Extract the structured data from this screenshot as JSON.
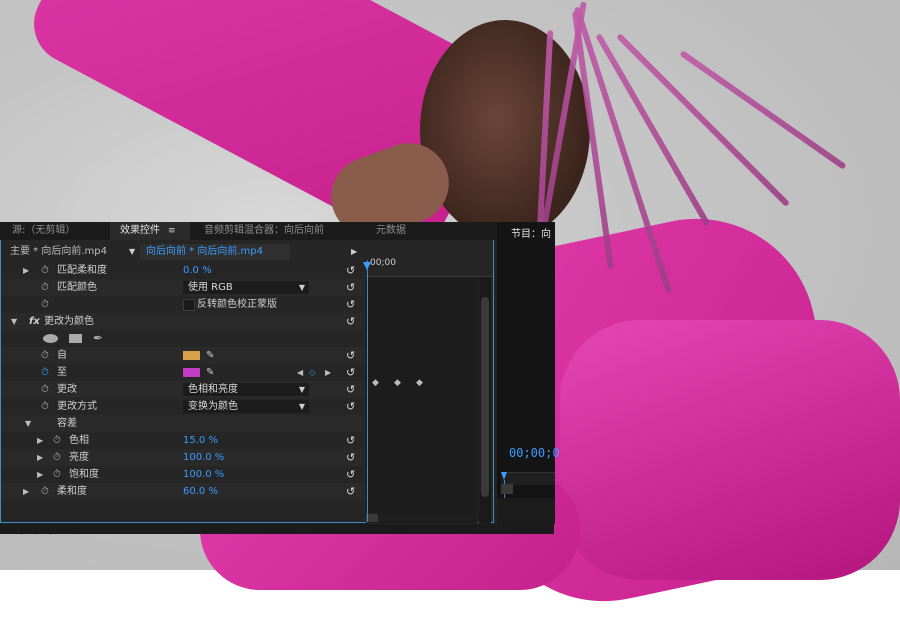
{
  "tabs": {
    "source": "源:（无剪辑）",
    "effect_controls": "效果控件",
    "menu_icon": "≡",
    "audio_mixer": "音频剪辑混合器：向后向前",
    "metadata": "元数据"
  },
  "header": {
    "main_clip": "主要 * 向后向前.mp4",
    "sequence_clip": "向后向前 * 向后向前.mp4",
    "timecode": "00;00"
  },
  "rows": {
    "match_softness": {
      "label": "匹配柔和度",
      "value": "0.0 %"
    },
    "match_colors": {
      "label": "匹配颜色",
      "value": "使用 RGB"
    },
    "invert": {
      "label": "反转颜色校正蒙版"
    },
    "effect": {
      "label": "更改为颜色"
    },
    "from": {
      "label": "自",
      "color": "#d9a24a"
    },
    "to": {
      "label": "至",
      "color": "#c13cc3"
    },
    "change": {
      "label": "更改",
      "value": "色相和亮度"
    },
    "change_by": {
      "label": "更改方式",
      "value": "变换为颜色"
    },
    "tolerance": {
      "label": "容差"
    },
    "hue": {
      "label": "色相",
      "value": "15.0 %"
    },
    "lightness": {
      "label": "亮度",
      "value": "100.0 %"
    },
    "saturation": {
      "label": "饱和度",
      "value": "100.0 %"
    },
    "softness": {
      "label": "柔和度",
      "value": "60.0 %"
    }
  },
  "footer": {
    "timecode": "00;00;00;00"
  },
  "program": {
    "tab": "节目：向",
    "timecode": "00;00;0"
  },
  "colors": {
    "accent": "#3b9cff",
    "panel_bg": "#232323"
  }
}
